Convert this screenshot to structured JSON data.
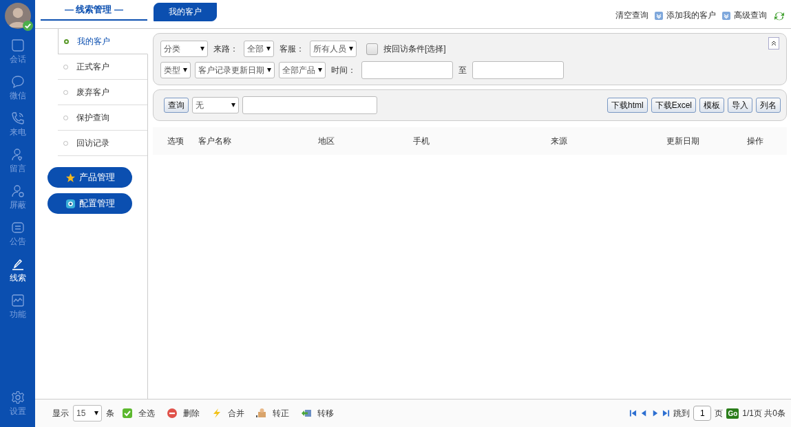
{
  "rail": {
    "items": [
      {
        "label": "会话",
        "selected": false
      },
      {
        "label": "微信",
        "selected": false
      },
      {
        "label": "来电",
        "selected": false
      },
      {
        "label": "留言",
        "selected": false
      },
      {
        "label": "屏蔽",
        "selected": false
      },
      {
        "label": "公告",
        "selected": false
      },
      {
        "label": "线索",
        "selected": true
      },
      {
        "label": "功能",
        "selected": false
      }
    ],
    "settings": "设置"
  },
  "section_title": "— 线索管理 —",
  "nav": [
    {
      "label": "我的客户",
      "selected": true
    },
    {
      "label": "正式客户",
      "selected": false
    },
    {
      "label": "废弃客户",
      "selected": false
    },
    {
      "label": "保护查询",
      "selected": false
    },
    {
      "label": "回访记录",
      "selected": false
    }
  ],
  "nav_buttons": [
    {
      "label": "产品管理",
      "kind": "star"
    },
    {
      "label": "配置管理",
      "kind": "gear"
    }
  ],
  "tabs": [
    {
      "label": "我的客户",
      "selected": true
    }
  ],
  "top_actions": [
    {
      "label": "清空查询",
      "kind": "plain"
    },
    {
      "label": "添加我的客户",
      "kind": "icon"
    },
    {
      "label": "高级查询",
      "kind": "icon"
    }
  ],
  "filter_rows": [
    [
      {
        "kind": "select",
        "value": "分类"
      },
      {
        "kind": "label",
        "text": "来路："
      },
      {
        "kind": "select",
        "value": "全部"
      },
      {
        "kind": "label",
        "text": "客服："
      },
      {
        "kind": "select",
        "value": "所有人员"
      },
      {
        "kind": "checkbox",
        "text": "按回访条件[选择]",
        "checked": false
      }
    ],
    [
      {
        "kind": "select",
        "value": "类型"
      },
      {
        "kind": "select",
        "value": "客户记录更新日期"
      },
      {
        "kind": "select",
        "value": "全部产品"
      },
      {
        "kind": "label",
        "text": "时间："
      },
      {
        "kind": "input"
      },
      {
        "kind": "label",
        "text": "至"
      },
      {
        "kind": "input"
      }
    ]
  ],
  "search": {
    "button": "查询",
    "field_select": "无",
    "buttons": [
      "下载html",
      "下载Excel",
      "模板",
      "导入",
      "列名"
    ]
  },
  "table": {
    "columns": [
      "选项",
      "客户名称",
      "地区",
      "手机",
      "来源",
      "更新日期",
      "操作"
    ]
  },
  "footer": {
    "show_label": "显示",
    "page_size": "15",
    "unit": "条",
    "actions": [
      {
        "label": "全选",
        "kind": "check"
      },
      {
        "label": "删除",
        "kind": "delete"
      },
      {
        "label": "合并",
        "kind": "bolt"
      },
      {
        "label": "转正",
        "kind": "box"
      },
      {
        "label": "转移",
        "kind": "move"
      }
    ],
    "jump_label": "跳到",
    "page": "1",
    "page_unit": "页",
    "go": "Go",
    "summary": "1/1页 共0条"
  }
}
